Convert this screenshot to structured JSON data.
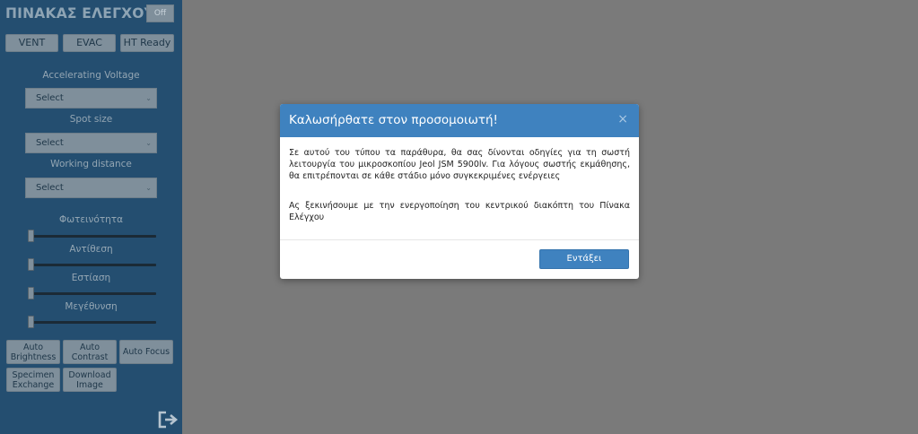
{
  "sidebar": {
    "title": "ΠΙΝΑΚΑΣ ΕΛΕΓΧΟΥ",
    "power_toggle": "Off",
    "top_buttons": [
      "VENT",
      "EVAC",
      "HT Ready"
    ],
    "selects": [
      {
        "label": "Accelerating Voltage",
        "value": "Select"
      },
      {
        "label": "Spot size",
        "value": "Select"
      },
      {
        "label": "Working distance",
        "value": "Select"
      }
    ],
    "sliders": [
      {
        "label": "Φωτεινότητα",
        "value": 0
      },
      {
        "label": "Αντίθεση",
        "value": 0
      },
      {
        "label": "Εστίαση",
        "value": 0
      },
      {
        "label": "Μεγέθυνση",
        "value": 0
      }
    ],
    "buttons_row1": [
      {
        "line1": "Auto",
        "line2": "Brightness"
      },
      {
        "line1": "Auto",
        "line2": "Contrast"
      },
      {
        "line1": "Auto Focus",
        "line2": ""
      }
    ],
    "buttons_row2": [
      {
        "line1": "Specimen",
        "line2": "Exchange"
      },
      {
        "line1": "Download",
        "line2": "Image"
      }
    ]
  },
  "modal": {
    "title": "Καλωσήρθατε στον προσομοιωτή!",
    "close": "×",
    "paragraph1": "Σε αυτού του τύπου τα παράθυρα, θα σας δίνονται οδηγίες για τη σωστή λειτουργία του μικροσκοπίου Jeol JSM 5900lv. Για λόγους σωστής εκμάθησης, θα επιτρέπονται σε κάθε στάδιο μόνο συγκεκριμένες ενέργειες",
    "paragraph2": "Ας ξεκινήσουμε με την ενεργοποίηση του κεντρικού διακόπτη του Πίνακα Ελέγχου",
    "ok_label": "Εντάξει"
  },
  "icons": {
    "exit": "exit-icon",
    "chevron": "chevron-down-icon",
    "close": "close-icon"
  },
  "colors": {
    "sidebar": "#244e70",
    "accent": "#3f82bf",
    "overlay": "#7a7a7a"
  }
}
